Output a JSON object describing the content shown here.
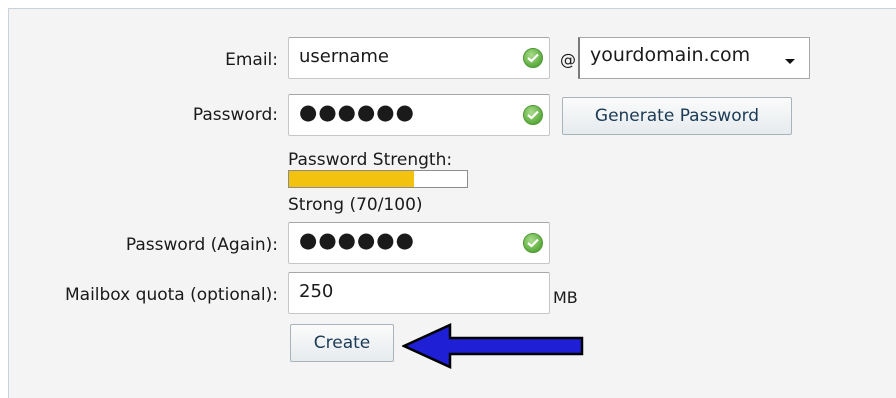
{
  "form": {
    "email": {
      "label": "Email:",
      "value": "username",
      "at_symbol": "@",
      "domain": "yourdomain.com"
    },
    "password": {
      "label": "Password:",
      "masked_value": "●●●●●●",
      "generate_button": "Generate Password"
    },
    "strength": {
      "label": "Password Strength:",
      "percent": 70,
      "text": "Strong (70/100)",
      "fill_color": "#f3c20f"
    },
    "password_again": {
      "label": "Password (Again):",
      "masked_value": "●●●●●●"
    },
    "quota": {
      "label": "Mailbox quota (optional):",
      "value": "250",
      "unit": "MB"
    },
    "create_button": "Create"
  },
  "colors": {
    "valid_check": "#5cab3e",
    "arrow": "#1f1fd6"
  },
  "icons": [
    "check-icon",
    "chevron-down-icon",
    "arrow-left-icon"
  ]
}
